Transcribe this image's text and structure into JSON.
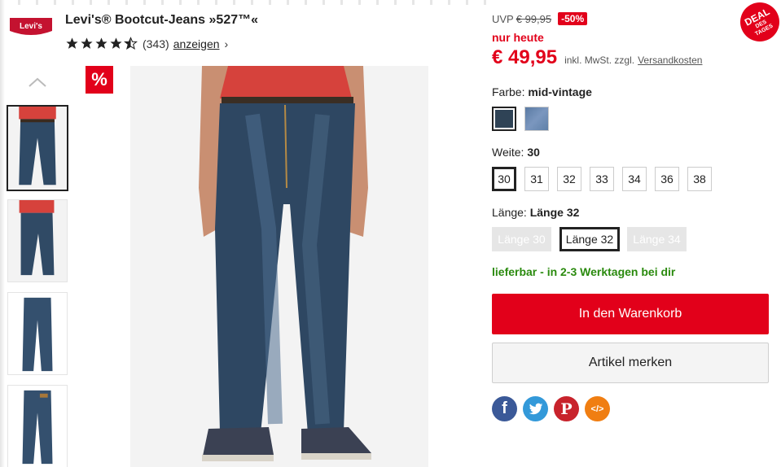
{
  "product": {
    "brand_logo_text": "Levi's",
    "title": "Levi's® Bootcut-Jeans »527™«",
    "rating": {
      "stars": 4.5,
      "count": "(343)",
      "link": "anzeigen"
    }
  },
  "badges": {
    "discount_symbol": "%",
    "deal": [
      "DEAL",
      "DES",
      "TAGES"
    ]
  },
  "price": {
    "uvp_label": "UVP",
    "uvp_old": "€ 99,95",
    "percent": "-50%",
    "today": "nur heute",
    "current": "€ 49,95",
    "vat": "inkl. MwSt. zzgl.",
    "shipping_link": "Versandkosten"
  },
  "color": {
    "label": "Farbe:",
    "selected": "mid-vintage",
    "swatches": [
      {
        "name": "mid-vintage",
        "color": "#2f4356"
      },
      {
        "name": "light",
        "color": "#6485ac"
      }
    ]
  },
  "width": {
    "label": "Weite:",
    "selected": "30",
    "options": [
      "30",
      "31",
      "32",
      "33",
      "34",
      "36",
      "38"
    ]
  },
  "length": {
    "label": "Länge:",
    "selected": "Länge 32",
    "options": [
      "Länge 30",
      "Länge 32",
      "Länge 34"
    ]
  },
  "availability": "lieferbar - in 2-3 Werktagen bei dir",
  "actions": {
    "cart": "In den Warenkorb",
    "wishlist": "Artikel merken"
  },
  "social": [
    {
      "icon": "facebook-icon",
      "glyph": "f",
      "color": "#3b5998"
    },
    {
      "icon": "twitter-icon",
      "glyph": "t",
      "color": "#3399d9"
    },
    {
      "icon": "pinterest-icon",
      "glyph": "P",
      "color": "#c8232c"
    },
    {
      "icon": "embed-code-icon",
      "glyph": "</>",
      "color": "#f07e12"
    }
  ],
  "colors": {
    "accent": "#e2001a",
    "available": "#2a8a0e"
  }
}
